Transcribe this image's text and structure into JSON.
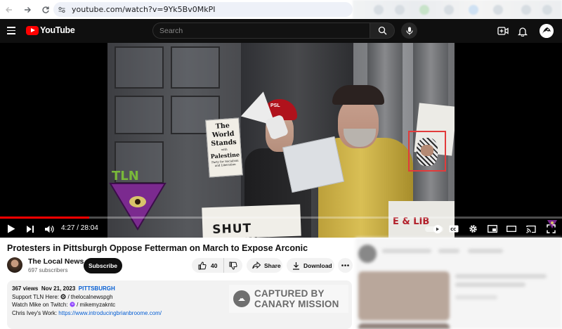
{
  "browser": {
    "url": "youtube.com/watch?v=9Yk5Bv0MkPI"
  },
  "header": {
    "logo_text": "YouTube",
    "search_placeholder": "Search"
  },
  "player": {
    "current_time": "4:27",
    "duration": "28:04",
    "time_display": "4:27 / 28:04",
    "progress_fraction": 0.159,
    "video_frame_text": {
      "sign_left_lines": [
        "The",
        "World",
        "Stands",
        "with",
        "Palestine"
      ],
      "sign_left_small": "Party for Socialism and Liberation",
      "hat_text": "PSL",
      "bottom_sign": "SHUT DOWN",
      "right_sign_partial": "E & LIB",
      "watermark": "TLN"
    }
  },
  "video": {
    "title": "Protesters in Pittsburgh Oppose Fetterman on March to Expose Arconic"
  },
  "channel": {
    "name": "The Local News",
    "subscribers": "697 subscribers",
    "subscribe_label": "Subscribe"
  },
  "actions": {
    "likes": "40",
    "share_label": "Share",
    "download_label": "Download"
  },
  "description": {
    "views": "367 views",
    "date": "Nov 21, 2023",
    "tag": "PITTSBURGH",
    "line1_prefix": "Support TLN Here:",
    "line1_handle": "/ thelocalnewspgh",
    "line2_prefix": "Watch Mike on Twitch:",
    "line2_handle": "/ mikemyzakntc",
    "line3_prefix": "Chris Ivey's Work:",
    "line3_link": "https://www.introducingbrianbroome.com/"
  },
  "overlay": {
    "line1": "CAPTURED BY",
    "line2": "CANARY MISSION"
  },
  "colors": {
    "youtube_red": "#ff0000",
    "header_bg": "#0f0f0f",
    "link_blue": "#065fd4",
    "kufiyah_box": "#e23b3b"
  }
}
